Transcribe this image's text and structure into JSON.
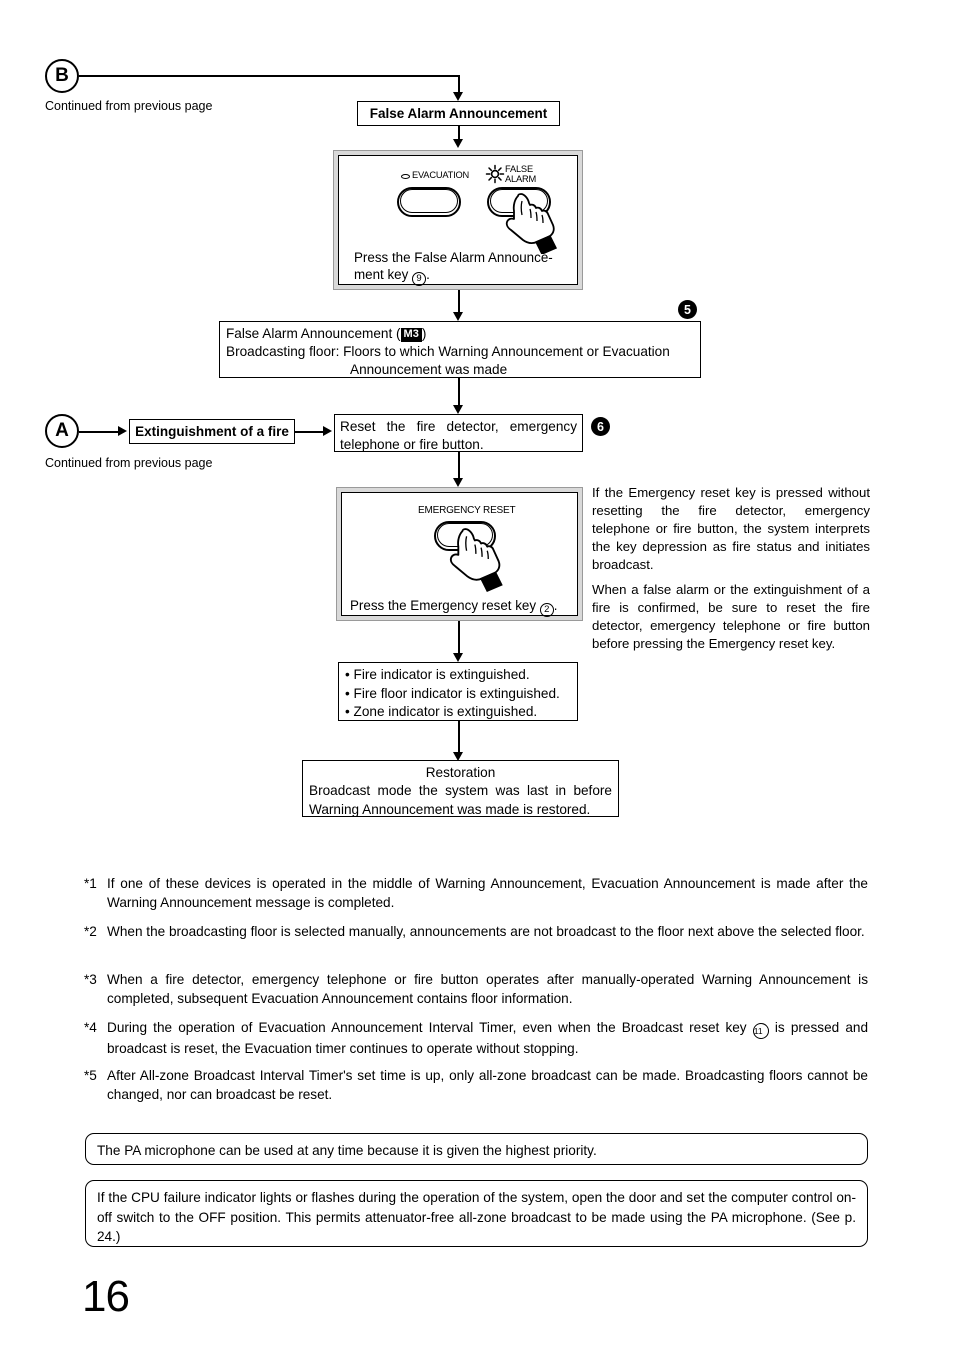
{
  "page": {
    "number": "16"
  },
  "connectors": {
    "b": {
      "label": "B",
      "caption": "Continued from previous page"
    },
    "a": {
      "label": "A",
      "caption": "Continued from previous page"
    }
  },
  "flow": {
    "false_alarm_header": "False Alarm Announcement",
    "extinguishment_box": "Extinguishment of a fire",
    "announcement_box": {
      "line1_prefix": "False Alarm Announcement (",
      "line1_badge": "M3",
      "line1_suffix": ")",
      "line2_label": "Broadcasting floor:",
      "line2_text": "Floors to which Warning Announcement or Evacuation",
      "line3_text": "Announcement was made",
      "step_marker": "5"
    },
    "reset_box": {
      "line1": "Reset the fire detector, emergency",
      "line2": "telephone or fire button.",
      "step_marker": "6"
    },
    "indicator_box": {
      "items": [
        "Fire indicator is extinguished.",
        "Fire floor indicator is extinguished.",
        "Zone indicator is extinguished."
      ]
    },
    "restoration_box": {
      "title": "Restoration",
      "line1": "Broadcast mode the system was last in before",
      "line2": "Warning Announcement was made is restored."
    }
  },
  "panels": {
    "false_alarm": {
      "key_left_label": "EVACUATION",
      "key_right_label_line1": "FALSE",
      "key_right_label_line2": "ALARM",
      "caption_line1": "Press the False Alarm Announce-",
      "caption_line2_prefix": "ment key",
      "caption_ref": "9",
      "caption_line2_suffix": "."
    },
    "emergency_reset": {
      "key_label": "EMERGENCY RESET",
      "caption_prefix": "Press the Emergency reset key",
      "caption_ref": "2",
      "caption_suffix": "."
    }
  },
  "sidenotes": [
    "If the Emergency reset key is pressed without resetting the fire detector, emergency telephone or fire button, the system interprets the key depression as fire status and initiates broadcast.",
    "When a false alarm or the extinguishment of a fire is confirmed, be sure to reset the fire detector, emergency telephone or fire button before pressing the Emergency reset key."
  ],
  "footnotes": [
    {
      "mark": "1",
      "text": "If one of these devices is operated in the middle of Warning Announcement, Evacuation Announcement is made after the Warning Announcement message is completed."
    },
    {
      "mark": "2",
      "text": "When the broadcasting floor is selected manually, announcements are not broadcast to the floor next above the selected floor."
    },
    {
      "mark": "3",
      "text": "When a fire detector, emergency telephone or fire button operates after manually-operated Warning Announcement is completed, subsequent Evacuation  Announcement contains floor information."
    },
    {
      "mark": "4",
      "text_before_ref": "During the operation of Evacuation Announcement Interval Timer, even when the Broadcast reset key",
      "ref": "11",
      "text_after_ref": "is pressed and broadcast is reset, the Evacuation timer continues to operate without stopping."
    },
    {
      "mark": "5",
      "text": "After All-zone Broadcast Interval Timer's set time is up, only all-zone broadcast can be made. Broadcasting floors cannot be changed, nor can broadcast be reset."
    }
  ],
  "notes": [
    "The PA microphone can be used at any time because it is given the highest priority.",
    "If the CPU failure indicator lights or flashes during the operation of the system, open the door and set the computer control on-off switch to the OFF position. This permits attenuator-free all-zone broadcast to be made using the PA microphone. (See p. 24.)"
  ]
}
